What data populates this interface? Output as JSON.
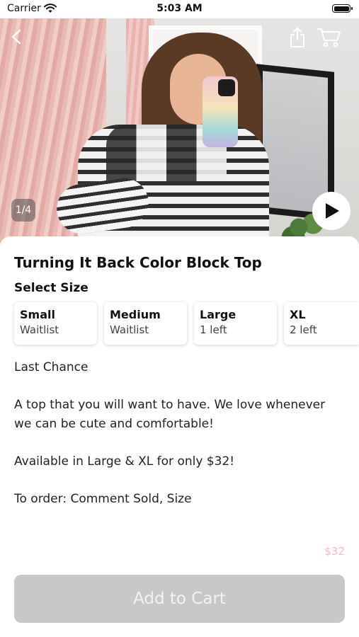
{
  "status_bar": {
    "carrier": "Carrier",
    "time": "5:03 AM"
  },
  "hero": {
    "page_indicator": "1/4",
    "icons": [
      "back-icon",
      "share-icon",
      "cart-icon",
      "play-icon"
    ]
  },
  "product": {
    "title": "Turning It Back Color Block Top",
    "select_size_label": "Select Size",
    "sizes": [
      {
        "name": "Small",
        "stock": "Waitlist"
      },
      {
        "name": "Medium",
        "stock": "Waitlist"
      },
      {
        "name": "Large",
        "stock": "1 left"
      },
      {
        "name": "XL",
        "stock": "2 left"
      }
    ],
    "description": [
      "Last Chance",
      "A top that you will want to have. We love whenever we can be cute and comfortable!",
      "Available in Large & XL for only $32!",
      "To order: Comment Sold, Size"
    ]
  },
  "footer": {
    "price": "$32",
    "add_to_cart_label": "Add to Cart",
    "price_color": "#f5b8c8",
    "button_color": "#c8c8c8"
  }
}
